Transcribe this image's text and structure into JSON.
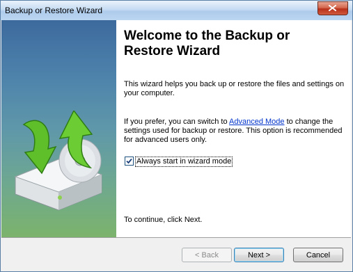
{
  "window": {
    "title": "Backup or Restore Wizard"
  },
  "wizard": {
    "heading": "Welcome to the Backup or Restore Wizard",
    "paragraph1": "This wizard helps you back up or restore the files and settings on your computer.",
    "paragraph2_before": "If you prefer, you can switch to ",
    "paragraph2_link": "Advanced Mode",
    "paragraph2_after": " to change the settings used for backup or restore. This option is recommended for advanced users only.",
    "checkbox": {
      "label": "Always start in wizard mode",
      "checked": true
    },
    "continue_text": "To continue, click Next."
  },
  "buttons": {
    "back": "< Back",
    "next": "Next >",
    "cancel": "Cancel"
  },
  "icons": {
    "side_art": "backup-drive-icon",
    "close": "close-icon"
  }
}
